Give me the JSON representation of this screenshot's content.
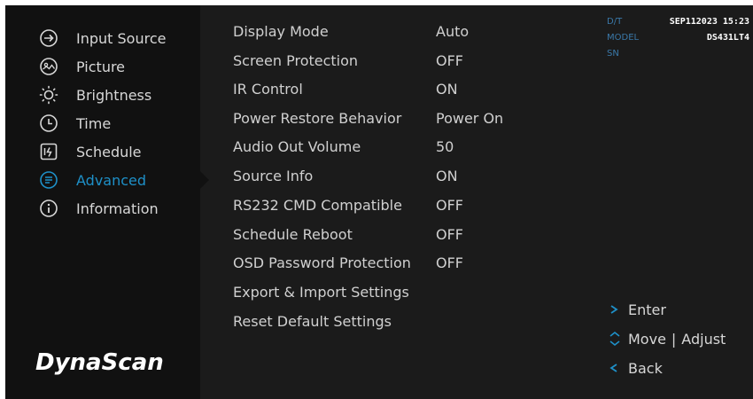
{
  "sidebar": {
    "items": [
      {
        "label": "Input Source",
        "icon": "input-source-icon"
      },
      {
        "label": "Picture",
        "icon": "picture-icon"
      },
      {
        "label": "Brightness",
        "icon": "brightness-icon"
      },
      {
        "label": "Time",
        "icon": "clock-icon"
      },
      {
        "label": "Schedule",
        "icon": "schedule-icon"
      },
      {
        "label": "Advanced",
        "icon": "advanced-icon",
        "active": true
      },
      {
        "label": "Information",
        "icon": "information-icon"
      }
    ],
    "logo": "DynaScan"
  },
  "settings": [
    {
      "label": "Display Mode",
      "value": "Auto"
    },
    {
      "label": "Screen Protection",
      "value": "OFF"
    },
    {
      "label": "IR Control",
      "value": "ON"
    },
    {
      "label": "Power Restore Behavior",
      "value": "Power On"
    },
    {
      "label": "Audio Out Volume",
      "value": "50"
    },
    {
      "label": "Source Info",
      "value": "ON"
    },
    {
      "label": "RS232 CMD Compatible",
      "value": "OFF"
    },
    {
      "label": "Schedule Reboot",
      "value": "OFF"
    },
    {
      "label": "OSD Password Protection",
      "value": "OFF"
    },
    {
      "label": "Export & Import Settings"
    },
    {
      "label": "Reset Default Settings"
    }
  ],
  "info": {
    "dt_label": "D/T",
    "dt_value": "SEP112023 15:23",
    "model_label": "MODEL",
    "model_value": "DS431LT4",
    "sn_label": "SN"
  },
  "hints": {
    "enter": "Enter",
    "move": "Move",
    "separator": "|",
    "adjust": "Adjust",
    "back": "Back"
  },
  "colors": {
    "accent": "#1e90c8",
    "background": "#1b1b1b",
    "sidebar": "#111111"
  }
}
